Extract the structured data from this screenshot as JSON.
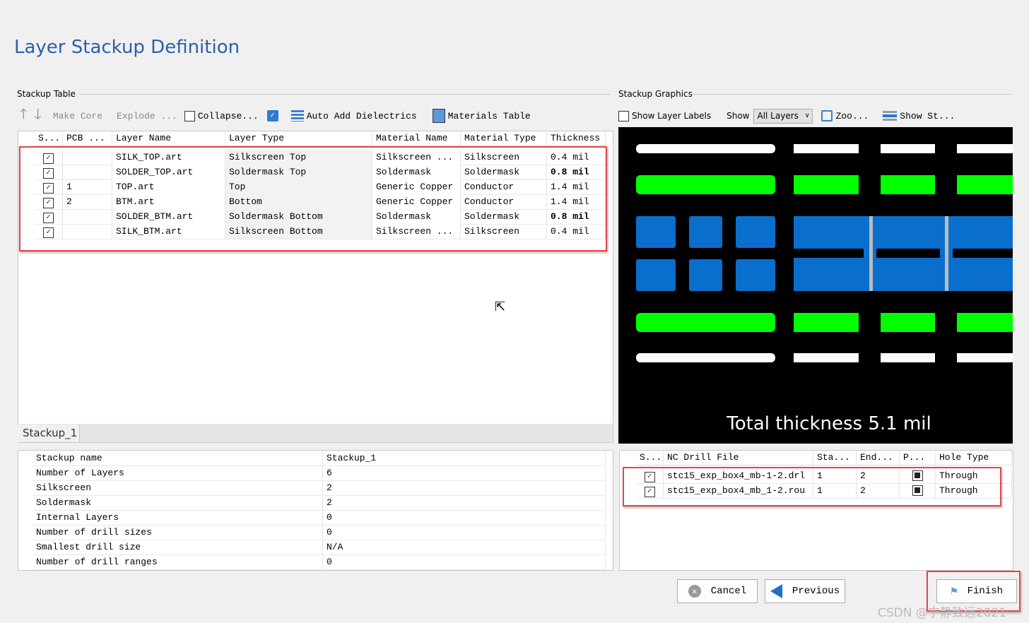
{
  "title": "Layer Stackup Definition",
  "stackup_table": {
    "group_label": "Stackup Table",
    "toolbar": {
      "make_core": "Make Core",
      "explode": "Explode ...",
      "collapse": "Collapse...",
      "auto_add": "Auto Add Dielectrics",
      "materials": "Materials Table"
    },
    "columns": [
      "S...",
      "PCB ...",
      "Layer Name",
      "Layer Type",
      "Material Name",
      "Material Type",
      "Thickness"
    ],
    "rows": [
      {
        "checked": true,
        "pcb": "",
        "name": "SILK_TOP.art",
        "type": "Silkscreen Top",
        "material": "Silkscreen ...",
        "mtype": "Silkscreen",
        "thickness": "0.4 mil",
        "bold": false
      },
      {
        "checked": true,
        "pcb": "",
        "name": "SOLDER_TOP.art",
        "type": "Soldermask Top",
        "material": "Soldermask",
        "mtype": "Soldermask",
        "thickness": "0.8 mil",
        "bold": true
      },
      {
        "checked": true,
        "pcb": "1",
        "name": "TOP.art",
        "type": "Top",
        "material": "Generic Copper",
        "mtype": "Conductor",
        "thickness": "1.4 mil",
        "bold": false
      },
      {
        "checked": true,
        "pcb": "2",
        "name": "BTM.art",
        "type": "Bottom",
        "material": "Generic Copper",
        "mtype": "Conductor",
        "thickness": "1.4 mil",
        "bold": false
      },
      {
        "checked": true,
        "pcb": "",
        "name": "SOLDER_BTM.art",
        "type": "Soldermask Bottom",
        "material": "Soldermask",
        "mtype": "Soldermask",
        "thickness": "0.8 mil",
        "bold": true
      },
      {
        "checked": true,
        "pcb": "",
        "name": "SILK_BTM.art",
        "type": "Silkscreen Bottom",
        "material": "Silkscreen ...",
        "mtype": "Silkscreen",
        "thickness": "0.4 mil",
        "bold": false
      }
    ],
    "tab": "Stackup_1"
  },
  "properties": [
    [
      "Stackup name",
      "Stackup_1"
    ],
    [
      "Number of Layers",
      "6"
    ],
    [
      "Silkscreen",
      "2"
    ],
    [
      "Soldermask",
      "2"
    ],
    [
      "Internal Layers",
      "0"
    ],
    [
      "Number of drill sizes",
      "0"
    ],
    [
      "Smallest drill size",
      "N/A"
    ],
    [
      "Number of drill ranges",
      "0"
    ]
  ],
  "graphics": {
    "group_label": "Stackup Graphics",
    "show_labels": "Show Layer Labels",
    "show": "Show",
    "show_value": "All Layers",
    "zoom": "Zoo...",
    "show_st": "Show St...",
    "total": "Total thickness 5.1 mil",
    "colors": {
      "silk": "#ffffff",
      "mask": "#00ff00",
      "copper": "#0a6ecd"
    }
  },
  "drill": {
    "columns": [
      "S...",
      "NC Drill File",
      "Sta...",
      "End...",
      "P...",
      "Hole Type"
    ],
    "rows": [
      {
        "checked": true,
        "file": "stc15_exp_box4_mb-1-2.drl",
        "start": "1",
        "end": "2",
        "hole": "Through"
      },
      {
        "checked": true,
        "file": "stc15_exp_box4_mb_1-2.rou",
        "start": "1",
        "end": "2",
        "hole": "Through"
      }
    ]
  },
  "buttons": {
    "cancel": "Cancel",
    "previous": "Previous",
    "finish": "Finish"
  },
  "watermark": "CSDN @宁静致远2021"
}
